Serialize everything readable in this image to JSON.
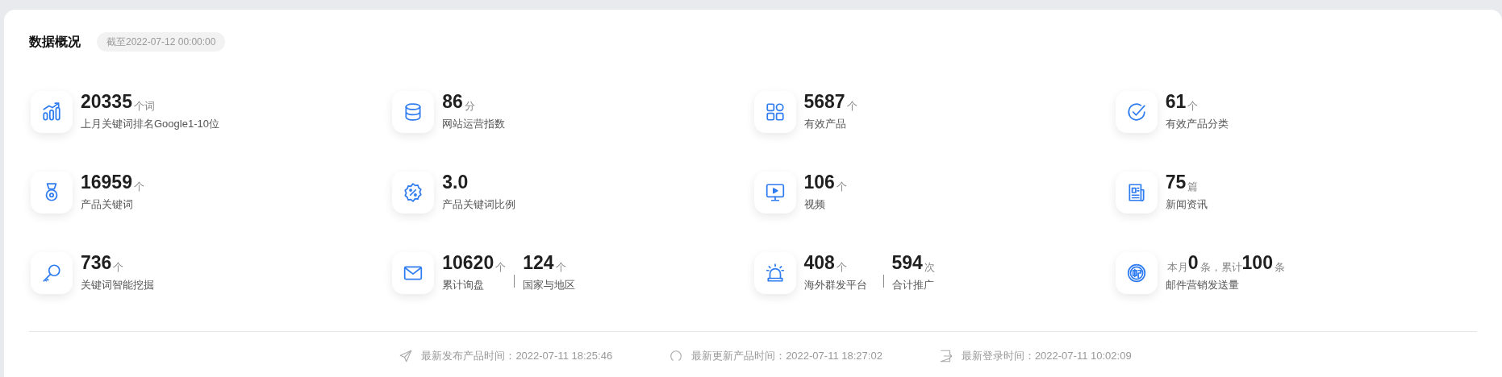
{
  "header": {
    "title": "数据概况",
    "date_badge": "截至2022-07-12 00:00:00"
  },
  "stats": [
    {
      "kind": "single",
      "value": "20335",
      "unit": "个词",
      "label": "上月关键词排名Google1-10位"
    },
    {
      "kind": "single",
      "value": "86",
      "unit": "分",
      "label": "网站运营指数"
    },
    {
      "kind": "single",
      "value": "5687",
      "unit": "个",
      "label": "有效产品"
    },
    {
      "kind": "single",
      "value": "61",
      "unit": "个",
      "label": "有效产品分类"
    },
    {
      "kind": "single",
      "value": "16959",
      "unit": "个",
      "label": "产品关键词"
    },
    {
      "kind": "single",
      "value": "3.0",
      "label": "产品关键词比例"
    },
    {
      "kind": "single",
      "value": "106",
      "unit": "个",
      "label": "视频"
    },
    {
      "kind": "single",
      "value": "75",
      "unit": "篇",
      "label": "新闻资讯"
    },
    {
      "kind": "single",
      "value": "736",
      "unit": "个",
      "label": "关键词智能挖掘"
    },
    {
      "kind": "double",
      "entries": [
        {
          "value": "10620",
          "unit": "个",
          "label": "累计询盘"
        },
        {
          "value": "124",
          "unit": "个",
          "label": "国家与地区"
        }
      ]
    },
    {
      "kind": "double",
      "entries": [
        {
          "value": "408",
          "unit": "个",
          "label": "海外群发平台"
        },
        {
          "value": "594",
          "unit": "次",
          "label": "合计推广"
        }
      ]
    },
    {
      "kind": "sentence",
      "parts": [
        {
          "kind": "unit",
          "text": "本月"
        },
        {
          "kind": "value",
          "text": "0"
        },
        {
          "kind": "unit",
          "text": "条，累计"
        },
        {
          "kind": "value",
          "text": "100"
        },
        {
          "kind": "unit",
          "text": "条"
        }
      ],
      "label": "邮件营销发送量"
    }
  ],
  "footer": [
    "最新发布产品时间：2022-07-11 18:25:46",
    "最新更新产品时间：2022-07-11 18:27:02",
    "最新登录时间：2022-07-11 10:02:09"
  ]
}
